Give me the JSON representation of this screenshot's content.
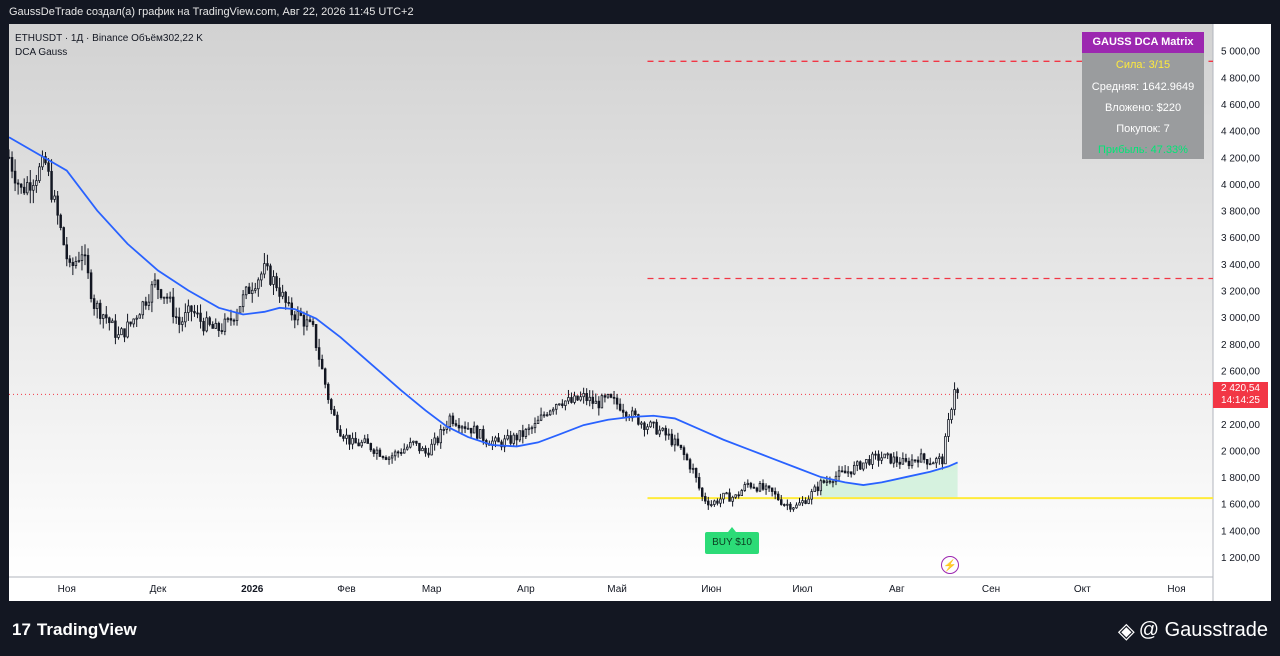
{
  "header": {
    "caption": "GaussDeTrade создал(а) график на TradingView.com, Авг 22, 2026 11:45 UTC+2"
  },
  "legend": {
    "symbol_line": "ETHUSDT · 1Д · Binance  Объём302,22 K",
    "indicator": "DCA Gauss"
  },
  "dca_panel": {
    "title": "GAUSS DCA Matrix",
    "strength": "Сила: 3/15",
    "average": "Средняя: 1642.9649",
    "invested": "Вложено: $220",
    "buys": "Покупок: 7",
    "profit": "Прибыль: 47.33%",
    "title_color": "#9c27b0",
    "strength_color": "#ffeb3b",
    "profit_color": "#00e676"
  },
  "price_badge": {
    "price": "2 420,54",
    "countdown": "14:14:25",
    "color": "#f23645"
  },
  "buy_tag": {
    "label": "BUY $10",
    "color": "#2cdb77"
  },
  "icons": {
    "lightning": "lightning-icon",
    "tv_logo": "tradingview-logo-icon",
    "diamond": "diamond-logo-icon"
  },
  "footer": {
    "brand": "TradingView",
    "handle": "@ Gausstrade"
  },
  "chart_data": {
    "type": "candlestick",
    "symbol": "ETHUSDT",
    "timeframe": "1Д",
    "exchange": "Binance",
    "y_range": [
      1050,
      5200
    ],
    "y_ticks": [
      1200,
      1400,
      1600,
      1800,
      2000,
      2200,
      2400,
      2600,
      2800,
      3000,
      3200,
      3400,
      3600,
      3800,
      4000,
      4200,
      4400,
      4600,
      4800,
      5000
    ],
    "y_tick_labels": [
      "1 200,00",
      "1 400,00",
      "1 600,00",
      "1 800,00",
      "2 000,00",
      "2 200,00",
      "2 400,00",
      "2 600,00",
      "2 800,00",
      "3 000,00",
      "3 200,00",
      "3 400,00",
      "3 600,00",
      "3 800,00",
      "4 000,00",
      "4 200,00",
      "4 400,00",
      "4 600,00",
      "4 800,00",
      "5 000,00"
    ],
    "x_labels": [
      {
        "label": "Ноя",
        "day": 0
      },
      {
        "label": "Дек",
        "day": 30
      },
      {
        "label": "2026",
        "day": 61
      },
      {
        "label": "Фев",
        "day": 92
      },
      {
        "label": "Мар",
        "day": 120
      },
      {
        "label": "Апр",
        "day": 151
      },
      {
        "label": "Май",
        "day": 181
      },
      {
        "label": "Июн",
        "day": 212
      },
      {
        "label": "Июл",
        "day": 242
      },
      {
        "label": "Авг",
        "day": 273
      },
      {
        "label": "Сен",
        "day": 304
      },
      {
        "label": "Окт",
        "day": 334
      },
      {
        "label": "Ноя",
        "day": 365
      }
    ],
    "x_range_days": [
      -19,
      377
    ],
    "close_path": [
      [
        -19,
        4200
      ],
      [
        -15,
        3950
      ],
      [
        -11,
        4050
      ],
      [
        -7,
        4150
      ],
      [
        -3,
        3750
      ],
      [
        1,
        3350
      ],
      [
        5,
        3500
      ],
      [
        9,
        3100
      ],
      [
        13,
        3000
      ],
      [
        17,
        2850
      ],
      [
        21,
        2950
      ],
      [
        25,
        3100
      ],
      [
        29,
        3250
      ],
      [
        33,
        3150
      ],
      [
        37,
        2950
      ],
      [
        41,
        3050
      ],
      [
        45,
        2950
      ],
      [
        49,
        2900
      ],
      [
        53,
        2950
      ],
      [
        57,
        3100
      ],
      [
        61,
        3250
      ],
      [
        65,
        3350
      ],
      [
        69,
        3250
      ],
      [
        73,
        3050
      ],
      [
        77,
        3000
      ],
      [
        81,
        2900
      ],
      [
        84,
        2600
      ],
      [
        87,
        2300
      ],
      [
        90,
        2150
      ],
      [
        94,
        2050
      ],
      [
        98,
        2050
      ],
      [
        102,
        2000
      ],
      [
        106,
        1950
      ],
      [
        110,
        2000
      ],
      [
        114,
        2050
      ],
      [
        118,
        1980
      ],
      [
        122,
        2080
      ],
      [
        126,
        2250
      ],
      [
        130,
        2200
      ],
      [
        134,
        2150
      ],
      [
        138,
        2080
      ],
      [
        142,
        2050
      ],
      [
        146,
        2080
      ],
      [
        150,
        2120
      ],
      [
        154,
        2180
      ],
      [
        158,
        2300
      ],
      [
        162,
        2380
      ],
      [
        166,
        2360
      ],
      [
        170,
        2400
      ],
      [
        174,
        2350
      ],
      [
        178,
        2380
      ],
      [
        182,
        2340
      ],
      [
        186,
        2260
      ],
      [
        190,
        2200
      ],
      [
        194,
        2160
      ],
      [
        198,
        2100
      ],
      [
        202,
        2000
      ],
      [
        206,
        1850
      ],
      [
        209,
        1650
      ],
      [
        212,
        1600
      ],
      [
        216,
        1650
      ],
      [
        220,
        1650
      ],
      [
        224,
        1750
      ],
      [
        228,
        1720
      ],
      [
        232,
        1680
      ],
      [
        236,
        1600
      ],
      [
        240,
        1580
      ],
      [
        244,
        1650
      ],
      [
        248,
        1750
      ],
      [
        252,
        1800
      ],
      [
        256,
        1830
      ],
      [
        260,
        1880
      ],
      [
        264,
        1930
      ],
      [
        268,
        1950
      ],
      [
        272,
        1930
      ],
      [
        276,
        1900
      ],
      [
        280,
        1950
      ],
      [
        284,
        1920
      ],
      [
        288,
        1930
      ],
      [
        290,
        2200
      ],
      [
        292,
        2480
      ],
      [
        293,
        2421
      ]
    ],
    "ma_path": [
      [
        -19,
        4350
      ],
      [
        0,
        4100
      ],
      [
        10,
        3800
      ],
      [
        20,
        3550
      ],
      [
        30,
        3350
      ],
      [
        40,
        3200
      ],
      [
        50,
        3070
      ],
      [
        58,
        3020
      ],
      [
        65,
        3040
      ],
      [
        70,
        3070
      ],
      [
        75,
        3060
      ],
      [
        82,
        2990
      ],
      [
        90,
        2850
      ],
      [
        100,
        2650
      ],
      [
        110,
        2450
      ],
      [
        118,
        2300
      ],
      [
        125,
        2180
      ],
      [
        132,
        2100
      ],
      [
        140,
        2040
      ],
      [
        148,
        2030
      ],
      [
        155,
        2060
      ],
      [
        162,
        2120
      ],
      [
        170,
        2190
      ],
      [
        178,
        2230
      ],
      [
        185,
        2250
      ],
      [
        193,
        2260
      ],
      [
        200,
        2240
      ],
      [
        208,
        2160
      ],
      [
        216,
        2080
      ],
      [
        224,
        2010
      ],
      [
        232,
        1940
      ],
      [
        240,
        1870
      ],
      [
        248,
        1800
      ],
      [
        256,
        1760
      ],
      [
        262,
        1740
      ],
      [
        268,
        1760
      ],
      [
        276,
        1800
      ],
      [
        284,
        1840
      ],
      [
        290,
        1880
      ],
      [
        293,
        1910
      ]
    ],
    "current_price": 2420.54,
    "support_line": {
      "value": 1642,
      "from_day": 191,
      "to_day": 377,
      "color": "#ffeb3b"
    },
    "resistance_lines": [
      {
        "value": 4920,
        "from_day": 191,
        "to_day": 377,
        "color": "#f23645"
      },
      {
        "value": 3290,
        "from_day": 191,
        "to_day": 377,
        "color": "#f23645"
      }
    ],
    "candle_color_up": "#131722",
    "ma_color": "#2962ff"
  }
}
